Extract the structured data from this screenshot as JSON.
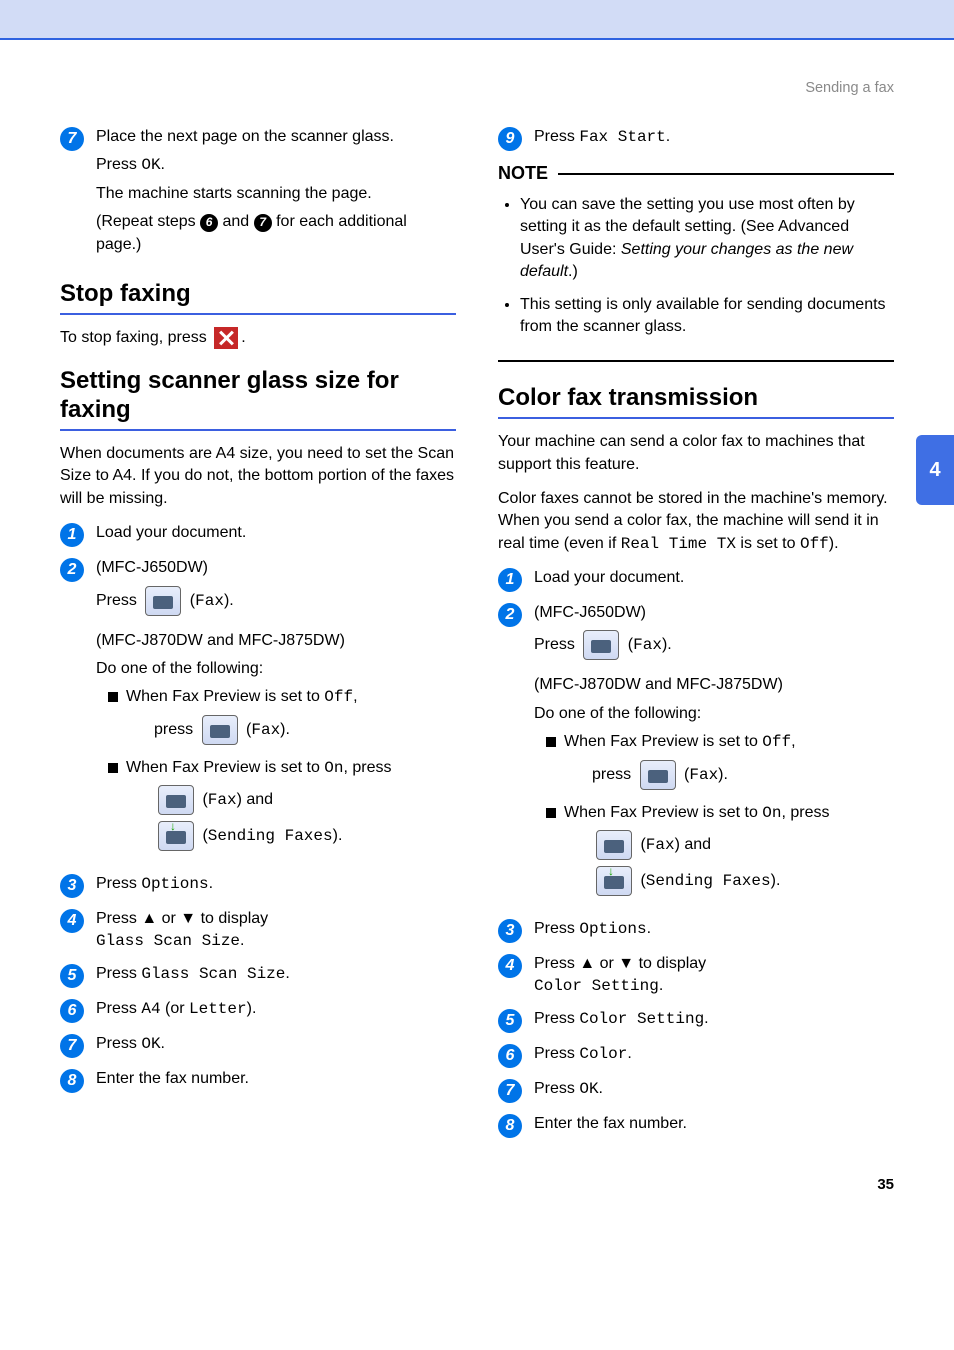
{
  "header": {
    "section": "Sending a fax"
  },
  "side_tab": "4",
  "page_number": "35",
  "left": {
    "step7": {
      "num": "7",
      "l1": "Place the next page on the scanner glass.",
      "l2a": "Press ",
      "l2b": "OK",
      "l2c": ".",
      "l3": "The machine starts scanning the page.",
      "l4a": "(Repeat steps ",
      "l4b": "6",
      "l4c": " and ",
      "l4d": "7",
      "l4e": " for each additional page.)"
    },
    "h_stop": "Stop faxing",
    "stop_a": "To stop faxing, press ",
    "stop_b": ".",
    "h_glass": "Setting scanner glass size for faxing",
    "glass_intro": "When documents are A4 size, you need to set the Scan Size to A4. If you do not, the bottom portion of the faxes will be missing.",
    "g1": {
      "num": "1",
      "text": "Load your document."
    },
    "g2": {
      "num": "2",
      "model1": "(MFC-J650DW)",
      "press": "Press ",
      "fax": "Fax",
      "dot": ".",
      "model2": "(MFC-J870DW and MFC-J875DW)",
      "do": "Do one of the following:",
      "off_a": "When Fax Preview is set to ",
      "off_b": "Off",
      "off_c": ",",
      "press2": "press ",
      "fax2": "Fax",
      "dot2": ".",
      "on_a": "When Fax Preview is set to ",
      "on_b": "On",
      "on_c": ", press",
      "fax3": "Fax",
      "and": " and",
      "send": "Sending Faxes",
      "dot3": "."
    },
    "g3": {
      "num": "3",
      "a": "Press ",
      "b": "Options",
      "c": "."
    },
    "g4": {
      "num": "4",
      "a": "Press ▲ or ▼ to display",
      "b": "Glass Scan Size",
      "c": "."
    },
    "g5": {
      "num": "5",
      "a": "Press ",
      "b": "Glass Scan Size",
      "c": "."
    },
    "g6": {
      "num": "6",
      "a": "Press ",
      "b": "A4",
      "c": " (or ",
      "d": "Letter",
      "e": ")."
    },
    "g7": {
      "num": "7",
      "a": "Press ",
      "b": "OK",
      "c": "."
    },
    "g8": {
      "num": "8",
      "a": "Enter the fax number."
    }
  },
  "right": {
    "r9": {
      "num": "9",
      "a": "Press ",
      "b": "Fax Start",
      "c": "."
    },
    "note_title": "NOTE",
    "note1a": "You can save the setting you use most often by setting it as the default setting. (See Advanced User's Guide: ",
    "note1b": "Setting your changes as the new default",
    "note1c": ".)",
    "note2": "This setting is only available for sending documents from the scanner glass.",
    "h_color": "Color fax transmission",
    "c_intro1": "Your machine can send a color fax to machines that support this feature.",
    "c_intro2a": "Color faxes cannot be stored in the machine's memory. When you send a color fax, the machine will send it in real time (even if ",
    "c_intro2b": "Real Time TX",
    "c_intro2c": " is set to ",
    "c_intro2d": "Off",
    "c_intro2e": ").",
    "c1": {
      "num": "1",
      "text": "Load your document."
    },
    "c2": {
      "num": "2",
      "model1": "(MFC-J650DW)",
      "press": "Press ",
      "fax": "Fax",
      "dot": ".",
      "model2": "(MFC-J870DW and MFC-J875DW)",
      "do": "Do one of the following:",
      "off_a": "When Fax Preview is set to ",
      "off_b": "Off",
      "off_c": ",",
      "press2": "press ",
      "fax2": "Fax",
      "dot2": ".",
      "on_a": "When Fax Preview is set to ",
      "on_b": "On",
      "on_c": ", press",
      "fax3": "Fax",
      "and": " and",
      "send": "Sending Faxes",
      "dot3": "."
    },
    "c3": {
      "num": "3",
      "a": "Press ",
      "b": "Options",
      "c": "."
    },
    "c4": {
      "num": "4",
      "a": "Press ▲ or ▼ to display",
      "b": "Color Setting",
      "c": "."
    },
    "c5": {
      "num": "5",
      "a": "Press ",
      "b": "Color Setting",
      "c": "."
    },
    "c6": {
      "num": "6",
      "a": "Press ",
      "b": "Color",
      "c": "."
    },
    "c7": {
      "num": "7",
      "a": "Press ",
      "b": "OK",
      "c": "."
    },
    "c8": {
      "num": "8",
      "a": "Enter the fax number."
    }
  }
}
